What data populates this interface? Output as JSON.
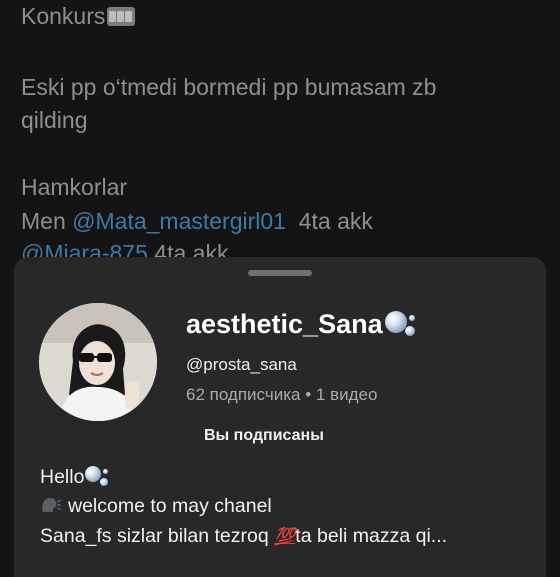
{
  "post": {
    "line1": "Konkurs",
    "line2": "Eski pp o‘tmedi bormedi pp bumasam zb",
    "line3": "qilding",
    "line4": "Hamkorlar",
    "line5_prefix": "Men ",
    "line5_mention": "@Mata_mastergirl01",
    "line5_suffix": "  4ta akk",
    "line6_mention": "@Miara-875",
    "line6_suffix": " 4ta akk",
    "slot_icon": "slot-machine-icon"
  },
  "channel_sheet": {
    "name": "aesthetic_Sana",
    "name_icon": "bubbles-icon",
    "handle": "@prosta_sana",
    "stats": "62 подписчика • 1 видео",
    "subscribed_label": "Вы подписаны",
    "description": {
      "line1": "Hello",
      "line2": "welcome to may chanel",
      "line3_prefix": "Sana_fs sizlar bilan tezroq ",
      "line3_badge": "💯",
      "line3_suffix": "ta beli mazza qi..."
    }
  },
  "colors": {
    "background": "#141414",
    "sheet": "#282828",
    "mention": "#3b7ba6",
    "muted": "#aaaaaa"
  }
}
